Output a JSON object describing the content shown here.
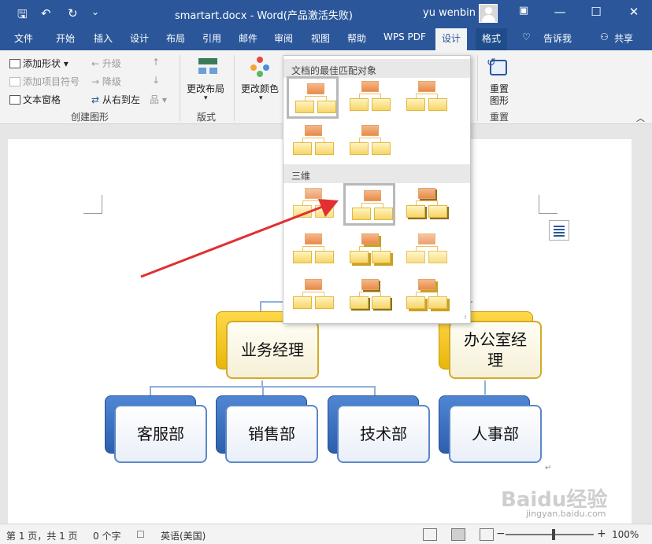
{
  "window": {
    "title": "smartart.docx  -  Word(产品激活失败)",
    "user": "yu wenbin",
    "controls": {
      "restore_icon": "ribbon-display-icon",
      "minimize": "—",
      "maximize": "☐",
      "close": "✕"
    }
  },
  "quick_access": {
    "save": "🖫",
    "undo": "↶",
    "redo": "↻",
    "customize": "⌄"
  },
  "tabs": [
    "文件",
    "开始",
    "插入",
    "设计",
    "布局",
    "引用",
    "邮件",
    "审阅",
    "视图",
    "帮助",
    "WPS PDF",
    "设计",
    "格式"
  ],
  "active_tab": "设计",
  "tell_me": "告诉我",
  "share": "共享",
  "ribbon": {
    "create_graphic": {
      "add_shape": "添加形状",
      "add_bullet": "添加项目符号",
      "text_pane": "文本窗格",
      "promote": "升级",
      "demote": "降级",
      "right_to_left": "从右到左",
      "group_label": "创建图形"
    },
    "layouts": {
      "change_layout": "更改布局",
      "group_label": "版式"
    },
    "styles": {
      "change_colors": "更改颜色"
    },
    "reset": {
      "reset_graphic": "重置图形",
      "reset_line1": "重置",
      "reset_line2": "图形",
      "group_label": "重置"
    }
  },
  "gallery": {
    "section_best": "文档的最佳匹配对象",
    "section_3d": "三维",
    "best_count": 5,
    "threed_count": 9,
    "selected_best_index": 0,
    "selected_3d_index": 1
  },
  "smartart": {
    "managers": [
      "业务经理",
      "办公室经理"
    ],
    "departments": [
      "客服部",
      "销售部",
      "技术部",
      "人事部"
    ],
    "colors": {
      "yellow": "#f5c518",
      "blue": "#3c70c2"
    }
  },
  "status": {
    "page": "第 1 页，共 1 页",
    "words": "0 个字",
    "language": "英语(美国)",
    "zoom": "100%",
    "zoom_minus": "−",
    "zoom_plus": "+"
  },
  "watermark": {
    "brand": "Baidu经验",
    "url": "jingyan.baidu.com"
  },
  "paragraph_mark": "↵"
}
